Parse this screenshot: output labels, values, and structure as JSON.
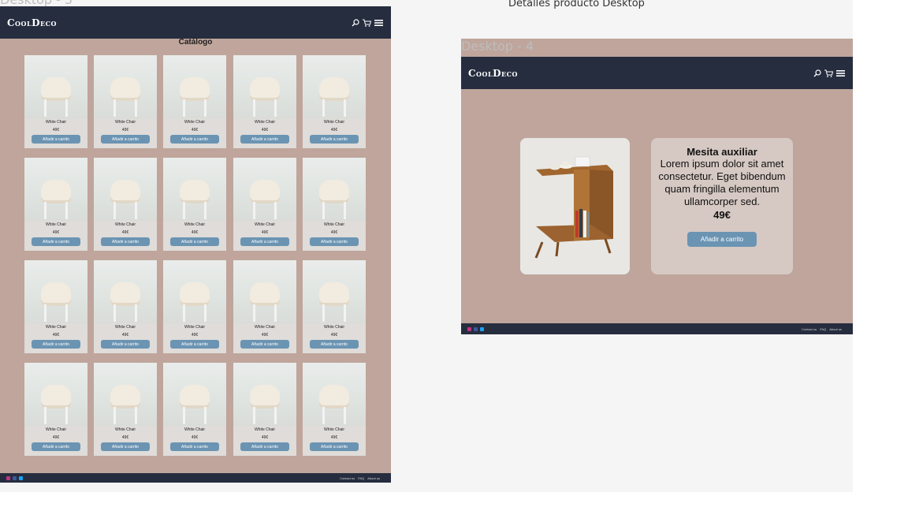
{
  "labels": {
    "desktop3_frame": "Desktop - 3",
    "desktop4_frame": "Desktop - 4",
    "detail_section": "Detalles producto Desktop"
  },
  "brand": {
    "logo": "CoolDeco"
  },
  "header_icons": [
    "search-icon",
    "cart-icon",
    "menu-icon"
  ],
  "catalog": {
    "title": "Catálogo",
    "product": {
      "name": "White Chair",
      "price": "49€",
      "button": "Añadir a carrito"
    }
  },
  "footer": {
    "links": [
      "Contact us",
      "FAQ",
      "About us"
    ]
  },
  "detail": {
    "title": "Mesita auxiliar",
    "description": "Lorem ipsum dolor sit amet consectetur. Eget bibendum quam fringilla elementum ullamcorper sed.",
    "price": "49€",
    "button": "Añadir a carrito"
  },
  "colors": {
    "header_bg": "#262d3f",
    "page_bg": "#bfa59b",
    "button": "#6b94b3",
    "card": "#dfdcd9",
    "info_card": "#d6c9c3",
    "instagram": "#c13584",
    "facebook": "#3b5998",
    "twitter": "#1da1f2"
  }
}
